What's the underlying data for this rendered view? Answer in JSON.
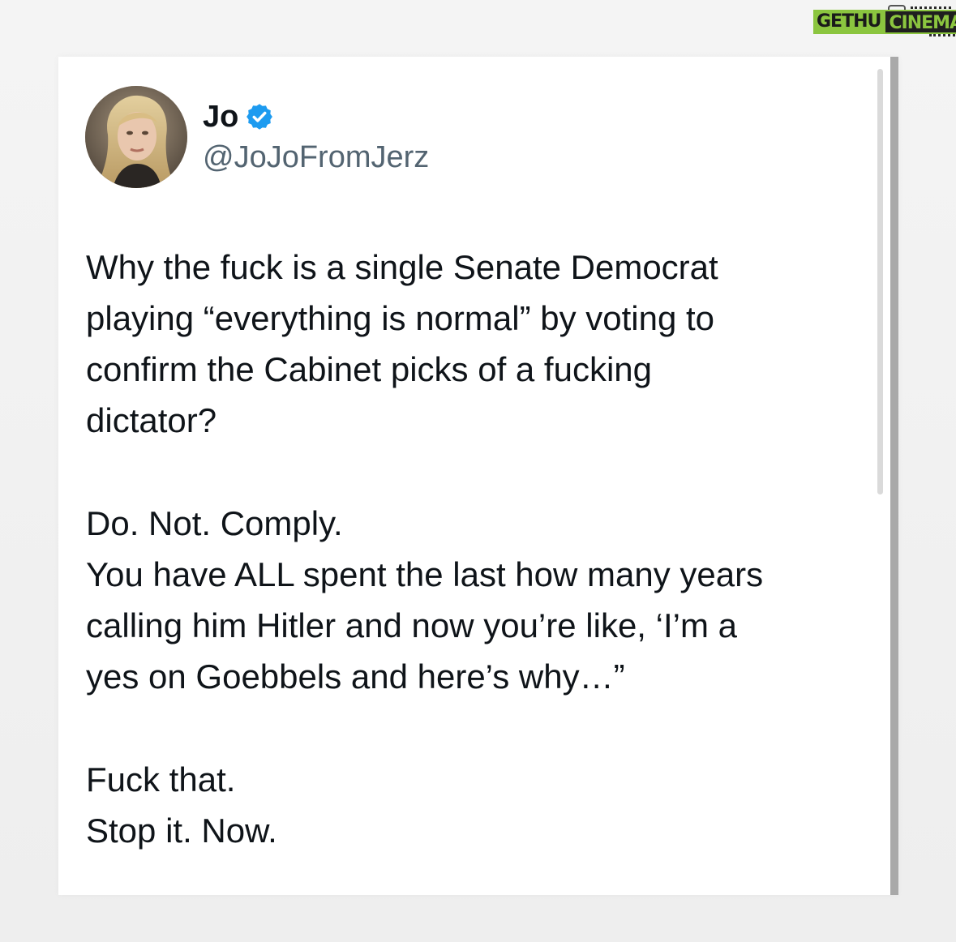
{
  "watermark": {
    "brand_part1": "GETHU",
    "brand_part2": "CINEMA",
    "colors": {
      "green": "#8bc53f",
      "dark": "#1f1f1f"
    }
  },
  "post": {
    "display_name": "Jo",
    "verified": true,
    "verified_icon": "verified-badge-icon",
    "handle": "@JoJoFromJerz",
    "avatar_icon": "profile-photo",
    "lines": [
      "Why the fuck is a single Senate Democrat",
      "playing “everything is normal” by voting to",
      "confirm the Cabinet picks of a fucking",
      "dictator?",
      "Do. Not. Comply.",
      "You have ALL spent the last how many years",
      "calling him Hitler and now you’re like, ‘I’m a",
      "yes on Goebbels and here’s why…”",
      "Fuck that.",
      "Stop it. Now."
    ]
  },
  "colors": {
    "text_primary": "#0f1419",
    "text_secondary": "#536471",
    "verified_blue": "#1d9bf0",
    "card_background": "#ffffff"
  }
}
